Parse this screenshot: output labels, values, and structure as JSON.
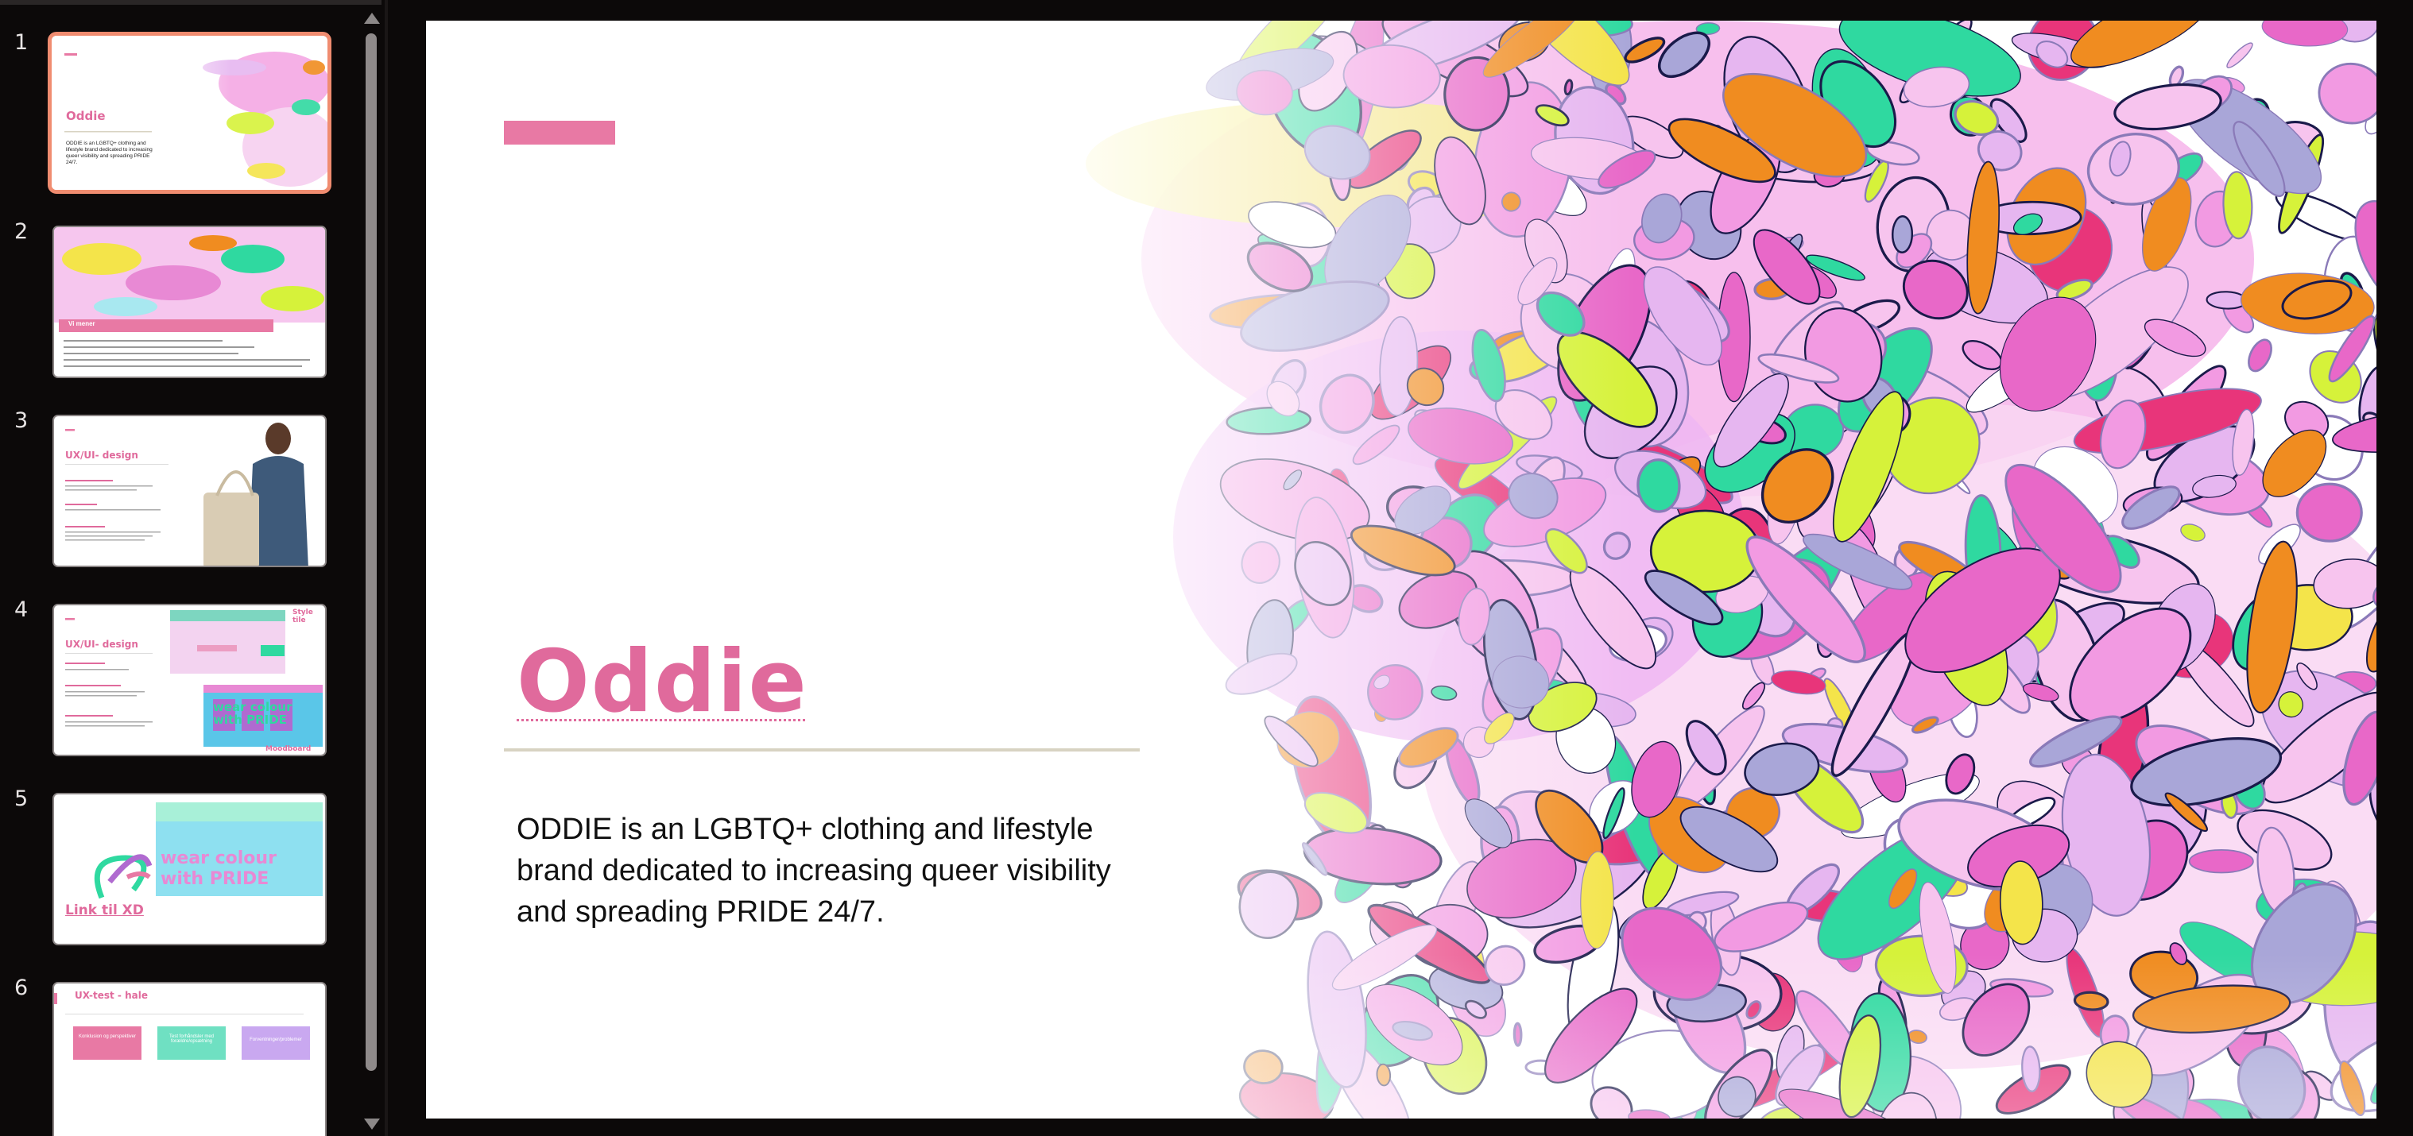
{
  "thumbnails": [
    {
      "number": "1",
      "title": "Oddie",
      "text": "ODDIE is an LGBTQ+ clothing and lifestyle brand dedicated to increasing queer visibility and spreading PRIDE 24/7."
    },
    {
      "number": "2",
      "title": "Vi mener"
    },
    {
      "number": "3",
      "title": "UX/UI- design"
    },
    {
      "number": "4",
      "title": "UX/UI- design",
      "style_tile": "Style tile",
      "moodboard": "Moodboard",
      "banner": "wear colour with PRIDE"
    },
    {
      "number": "5",
      "banner": "wear colour with PRIDE",
      "link": "Link til XD"
    },
    {
      "number": "6",
      "title": "UX-test - hale",
      "boxes": [
        "Konklusion og perspektiver",
        "Test forhåndsler med forældre/opsætning",
        "Forventninger/problemer"
      ]
    }
  ],
  "slide": {
    "title": "Oddie",
    "body": "ODDIE is an LGBTQ+ clothing and lifestyle brand dedicated to increasing queer visibility and spreading PRIDE 24/7."
  },
  "colors": {
    "accent_pink": "#e879a4",
    "title_pink": "#e06a9c",
    "active_border": "#f08c70",
    "rule": "#d8d3c2",
    "panel_bg": "#0c0909"
  },
  "icons": [
    "scroll-up-arrow-icon",
    "scroll-down-arrow-icon"
  ]
}
